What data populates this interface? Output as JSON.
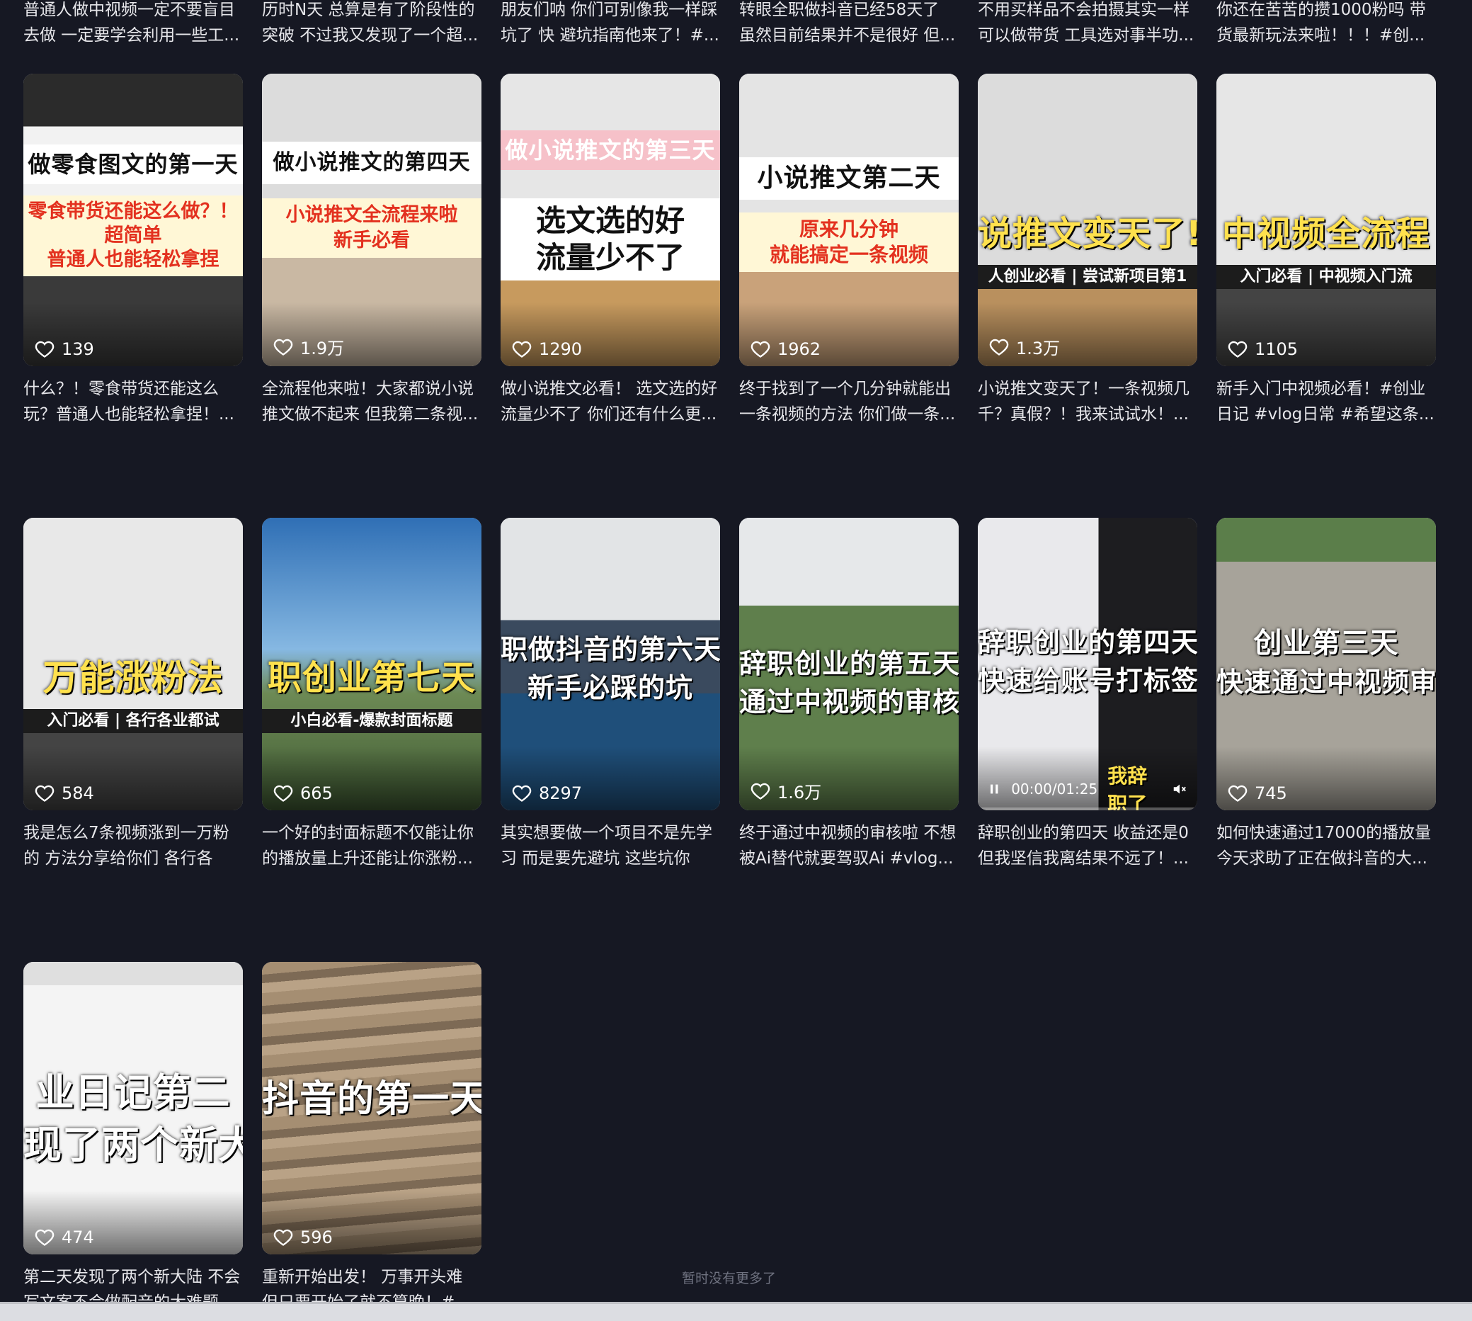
{
  "top_row": [
    {
      "desc": "普通人做中视频一定不要盲目去做 一定要学会利用一些工..."
    },
    {
      "desc": "历时N天 总算是有了阶段性的突破 不过我又发现了一个超..."
    },
    {
      "desc": "朋友们呐 你们可别像我一样踩坑了 快 避坑指南他来了！#..."
    },
    {
      "desc": "转眼全职做抖音已经58天了 虽然目前结果并不是很好 但..."
    },
    {
      "desc": "不用买样品不会拍摄其实一样可以做带货 工具选对事半功..."
    },
    {
      "desc": "你还在苦苦的攒1000粉吗 带货最新玩法来啦！！！#创..."
    }
  ],
  "cards": [
    {
      "likes": "139",
      "caption": "什么？！零食带货还能这么玩？普通人也能轻松拿捏！...",
      "title": "做零食图文的第一天",
      "banner": "零食带货还能这么做？！\n超简单\n普通人也能轻松拿捏"
    },
    {
      "likes": "1.9万",
      "caption": "全流程他来啦！大家都说小说推文做不起来 但我第二条视...",
      "title": "做小说推文的第四天",
      "banner": "小说推文全流程来啦\n新手必看"
    },
    {
      "likes": "1290",
      "caption": "做小说推文必看！ 选文选的好流量少不了 你们还有什么更...",
      "title": "做小说推文的第三天",
      "banner": "选文选的好\n流量少不了"
    },
    {
      "likes": "1962",
      "caption": "终于找到了一个几分钟就能出一条视频的方法 你们做一条...",
      "title": "小说推文第二天",
      "banner": "原来几分钟\n就能搞定一条视频"
    },
    {
      "likes": "1.3万",
      "caption": "小说推文变天了！一条视频几千？真假？！我来试试水！...",
      "title": "说推文变天了!",
      "sub": "人创业必看 | 尝试新项目第1"
    },
    {
      "likes": "1105",
      "caption": "新手入门中视频必看！#创业日记 #vlog日常 #希望这条...",
      "title": "中视频全流程",
      "sub": "入门必看 | 中视频入门流"
    },
    {
      "likes": "584",
      "caption": "我是怎么7条视频涨到一万粉的 方法分享给你们 各行各业...",
      "title": "万能涨粉法",
      "sub": "入门必看 | 各行各业都试"
    },
    {
      "likes": "665",
      "caption": "一个好的封面标题不仅能让你的播放量上升还能让你涨粉...",
      "title": "职创业第七天",
      "sub": "小白必看-爆款封面标题"
    },
    {
      "likes": "8297",
      "caption": "其实想要做一个项目不是先学习 而是要先避坑 这些坑你们...",
      "title": "职做抖音的第六天",
      "title2": "新手必踩的坑"
    },
    {
      "likes": "1.6万",
      "caption": "终于通过中视频的审核啦 不想被Ai替代就要驾驭Ai #vlog...",
      "title": "辞职创业的第五天",
      "title2": "通过中视频的审核"
    },
    {
      "likes": "",
      "caption": "辞职创业的第四天 收益还是0 但我坚信我离结果不远了！...",
      "title": "辞职创业的第四天",
      "title2": "快速给账号打标签",
      "time": "00:00/01:25",
      "subtitle": "我辞职了"
    },
    {
      "likes": "745",
      "caption": "如何快速通过17000的播放量 今天求助了正在做抖音的大...",
      "title": "创业第三天",
      "title2": "快速通过中视频审"
    },
    {
      "likes": "474",
      "caption": "第二天发现了两个新大陆 不会写文案不会做配音的大难题...",
      "title": "业日记第二",
      "title2": "现了两个新大"
    },
    {
      "likes": "596",
      "caption": "重新开始出发！ 万事开头难 但只要开始了就不算晚！#...",
      "title": "抖音的第一天"
    }
  ],
  "player": {
    "progress": 0.0
  },
  "end_text": "暂时没有更多了",
  "colors": {
    "background": "#161823",
    "banner_red": "#e3311f",
    "title_yellow": "#ffe14d"
  }
}
